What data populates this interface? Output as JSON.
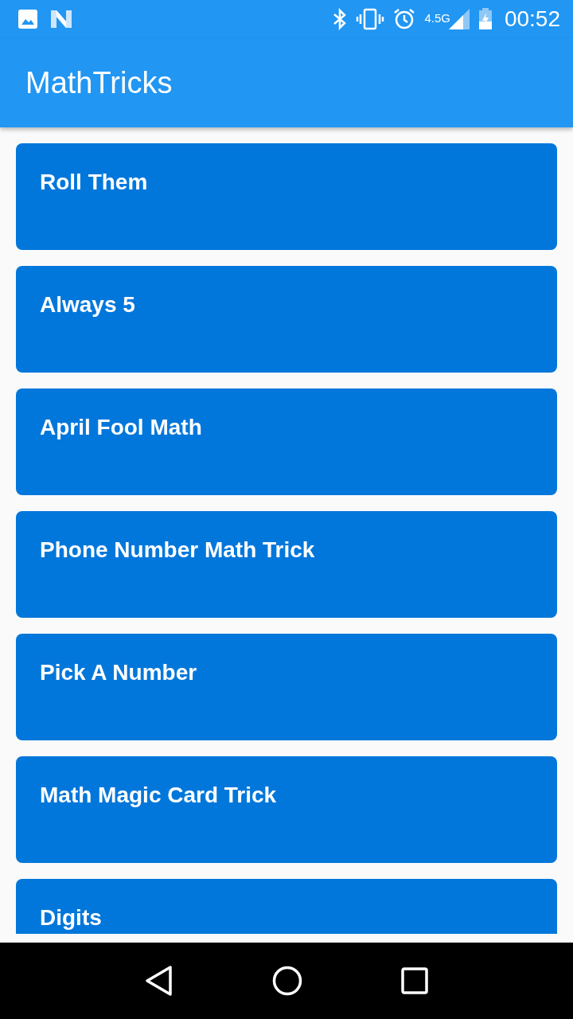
{
  "status_bar": {
    "network": "4.5G",
    "time": "00:52"
  },
  "app_bar": {
    "title": "MathTricks"
  },
  "tricks": [
    {
      "title": "Roll Them"
    },
    {
      "title": "Always 5"
    },
    {
      "title": "April Fool Math"
    },
    {
      "title": "Phone Number Math Trick"
    },
    {
      "title": "Pick A Number"
    },
    {
      "title": "Math Magic Card Trick"
    },
    {
      "title": "Digits"
    }
  ]
}
